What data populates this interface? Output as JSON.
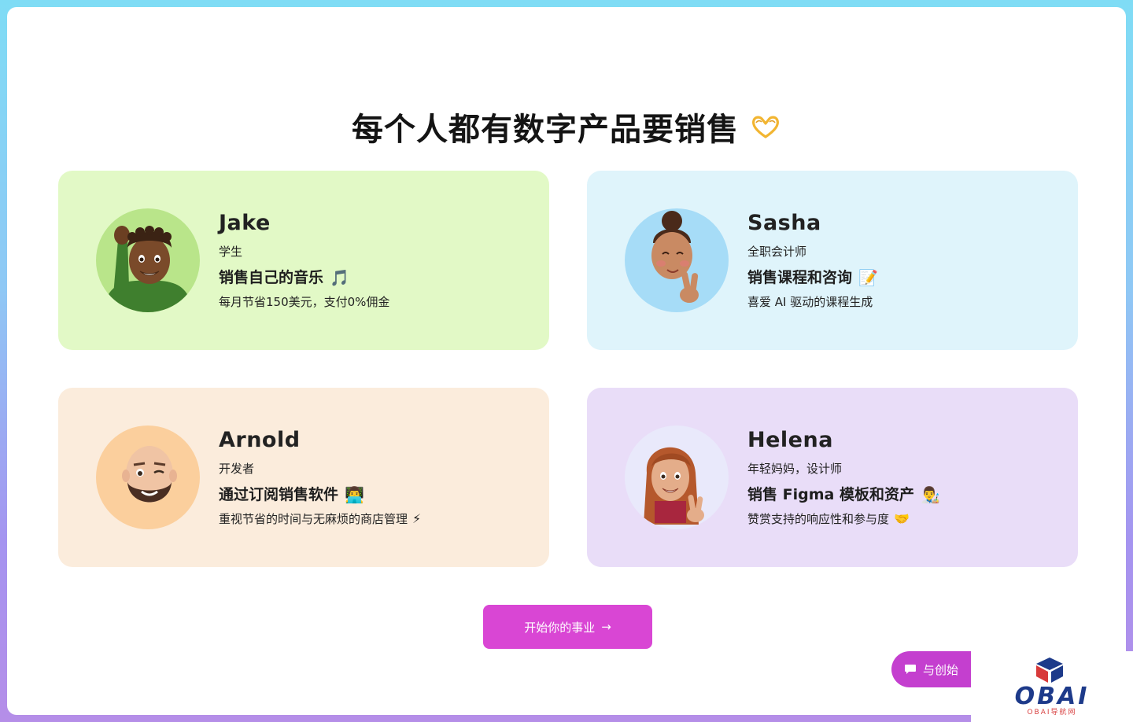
{
  "page": {
    "headline": "每个人都有数字产品要销售",
    "headline_icon": "heart-hands-icon"
  },
  "personas": [
    {
      "name": "Jake",
      "role": "学生",
      "pitch": "销售自己的音乐",
      "pitch_icon": "🎵",
      "benefit": "每月节省150美元，支付0%佣金",
      "benefit_icon": "",
      "card_color": "#e2f9c6",
      "avatar_bg": "#b9e58a"
    },
    {
      "name": "Sasha",
      "role": "全职会计师",
      "pitch": "销售课程和咨询",
      "pitch_icon": "📝",
      "benefit": "喜爱 AI 驱动的课程生成",
      "benefit_icon": "",
      "card_color": "#dff4fb",
      "avatar_bg": "#a6dcf7"
    },
    {
      "name": "Arnold",
      "role": "开发者",
      "pitch": "通过订阅销售软件",
      "pitch_icon": "👨‍💻",
      "benefit": "重视节省的时间与无麻烦的商店管理",
      "benefit_icon": "⚡",
      "card_color": "#fbecdc",
      "avatar_bg": "#fbcf9d"
    },
    {
      "name": "Helena",
      "role": "年轻妈妈，设计师",
      "pitch": "销售 Figma 模板和资产",
      "pitch_icon": "👨‍🎨",
      "benefit": "赞赏支持的响应性和参与度",
      "benefit_icon": "🤝",
      "card_color": "#e9ddf8",
      "avatar_bg": "#e9e9fb"
    }
  ],
  "cta": {
    "label": "开始你的事业",
    "arrow": "→"
  },
  "chat": {
    "label": "与创始",
    "icon": "chat-bubble-icon"
  },
  "watermark": {
    "brand": "OBAI",
    "sub": "OBAI导航网"
  },
  "colors": {
    "cta": "#d946d4",
    "chat": "#c43fcf",
    "watermark_blue": "#1d3a8a",
    "watermark_red": "#d84040"
  }
}
